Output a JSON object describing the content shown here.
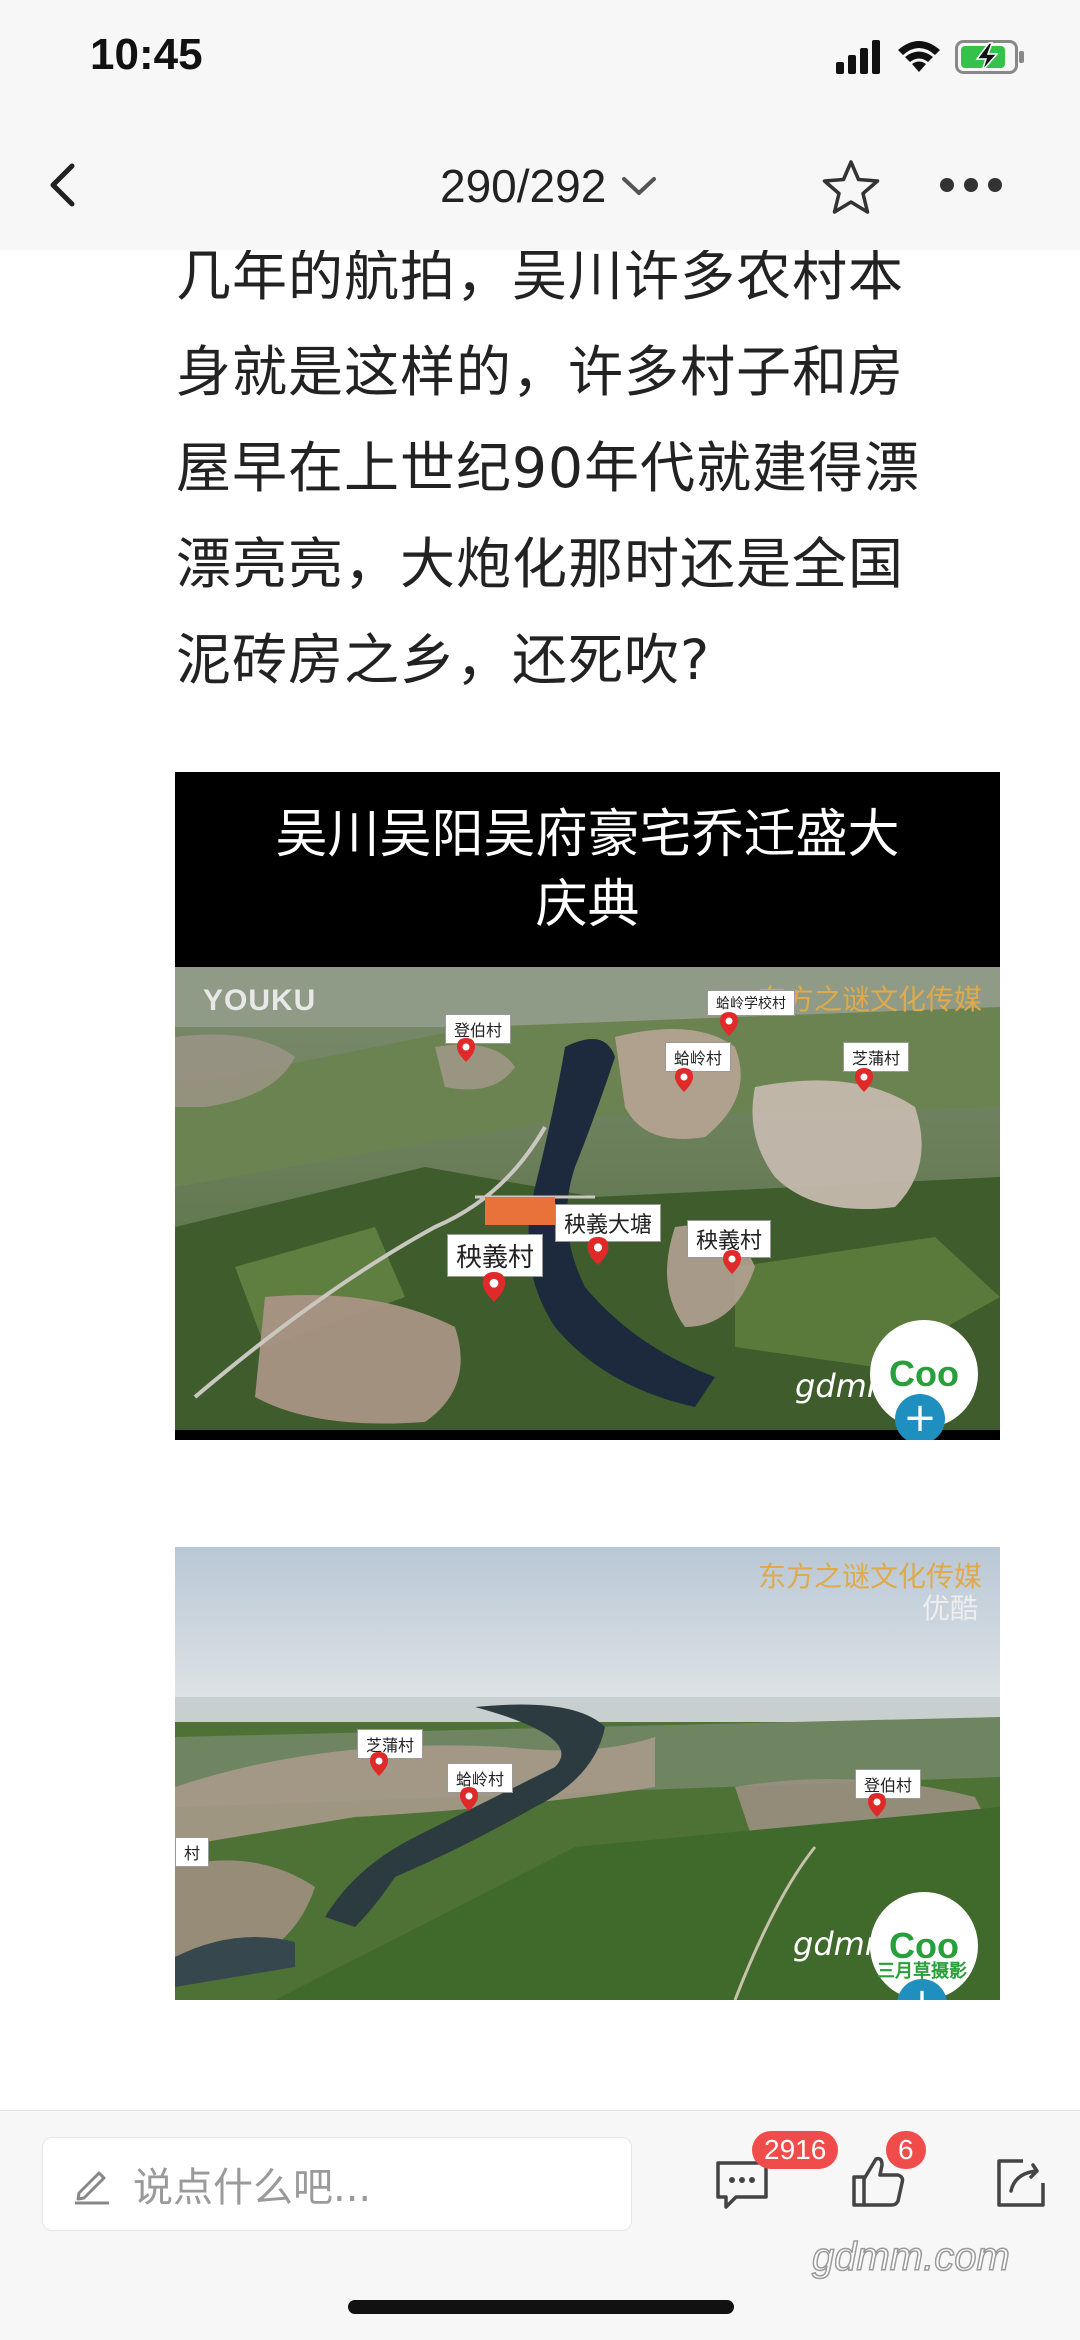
{
  "status_bar": {
    "time": "10:45"
  },
  "nav": {
    "page_indicator": "290/292"
  },
  "article": {
    "lines": [
      "几年的航拍，吴川许多农村本",
      "身就是这样的，许多村子和房",
      "屋早在上世纪90年代就建得漂",
      "漂亮亮，大炮化那时还是全国",
      "泥砖房之乡，还死吹?"
    ],
    "image1": {
      "caption_line1": "吴川吴阳吴府豪宅乔迁盛大",
      "caption_line2": "庆典",
      "watermark_left": "YOUKU",
      "watermark_right": "东方之谜文化传媒",
      "site_mark": "gdmm.com",
      "pins": [
        "秧義村",
        "秧義大塘",
        "秧義村",
        "蛤岭村",
        "蛤岭学校村",
        "芝蒲村",
        "登伯村"
      ]
    },
    "image2": {
      "watermark_right": "东方之谜文化传媒",
      "watermark_right2": "优酷",
      "site_mark": "gdmm.com",
      "badge_caption": "三月草摄影",
      "pins": [
        "芝蒲村",
        "蛤岭村",
        "登伯村",
        "村"
      ]
    }
  },
  "bottom_bar": {
    "comment_placeholder": "说点什么吧...",
    "comment_count": "2916",
    "like_count": "6"
  },
  "watermark": "gdmm.com",
  "colors": {
    "badge_red": "#f14c4c",
    "bar_background": "#f7f7f7",
    "text": "#222222"
  }
}
